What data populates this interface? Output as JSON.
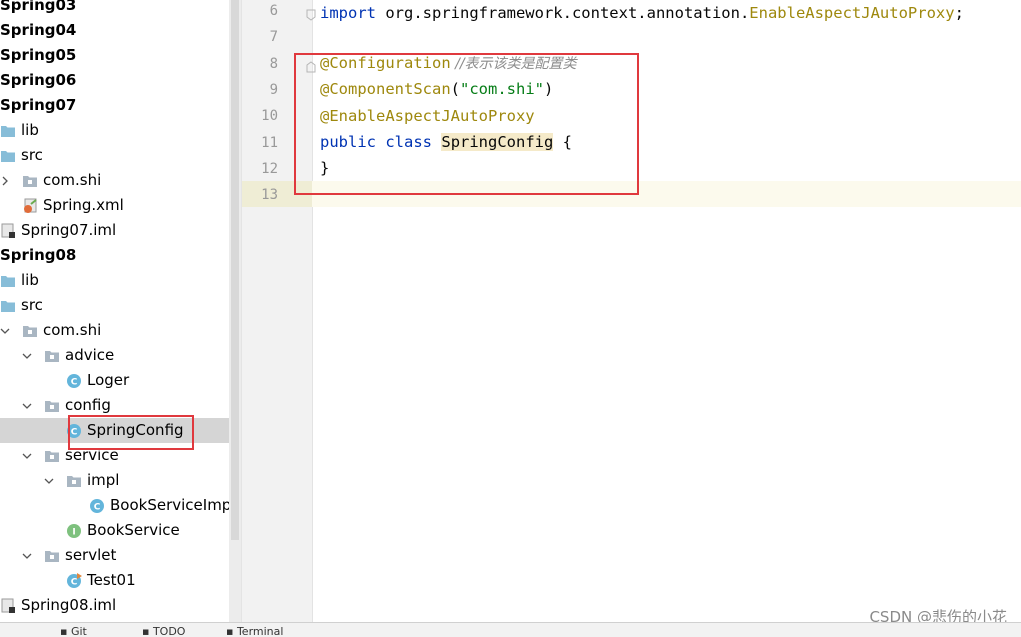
{
  "project_tree": {
    "items": [
      {
        "label": "Spring03",
        "kind": "module"
      },
      {
        "label": "Spring04",
        "kind": "module"
      },
      {
        "label": "Spring05",
        "kind": "module"
      },
      {
        "label": "Spring06",
        "kind": "module"
      },
      {
        "label": "Spring07",
        "kind": "module"
      },
      {
        "label": "lib",
        "kind": "folder"
      },
      {
        "label": "src",
        "kind": "folder"
      },
      {
        "label": "com.shi",
        "kind": "package"
      },
      {
        "label": "Spring.xml",
        "kind": "xml"
      },
      {
        "label": "Spring07.iml",
        "kind": "iml"
      },
      {
        "label": "Spring08",
        "kind": "module"
      },
      {
        "label": "lib",
        "kind": "folder"
      },
      {
        "label": "src",
        "kind": "folder"
      },
      {
        "label": "com.shi",
        "kind": "package"
      },
      {
        "label": "advice",
        "kind": "package"
      },
      {
        "label": "Loger",
        "kind": "class"
      },
      {
        "label": "config",
        "kind": "package"
      },
      {
        "label": "SpringConfig",
        "kind": "class",
        "selected": true
      },
      {
        "label": "service",
        "kind": "package"
      },
      {
        "label": "impl",
        "kind": "package"
      },
      {
        "label": "BookServiceImp",
        "kind": "class"
      },
      {
        "label": "BookService",
        "kind": "interface"
      },
      {
        "label": "servlet",
        "kind": "package"
      },
      {
        "label": "Test01",
        "kind": "class-run"
      },
      {
        "label": "Spring08.iml",
        "kind": "iml"
      }
    ]
  },
  "editor": {
    "line_numbers": [
      "6",
      "7",
      "8",
      "9",
      "10",
      "11",
      "12",
      "13"
    ],
    "lines": {
      "l6_kw": "import",
      "l6_pkg": " org.springframework.context.annotation.",
      "l6_cls": "EnableAspectJAutoProxy",
      "l6_end": ";",
      "l8_ann": "@Configuration",
      "l8_cmt": " //表示该类是配置类",
      "l9_ann": "@ComponentScan",
      "l9_open": "(",
      "l9_str": "\"com.shi\"",
      "l9_close": ")",
      "l10_ann": "@EnableAspectJAutoProxy",
      "l11_kw1": "public",
      "l11_sp": " ",
      "l11_kw2": "class",
      "l11_sp2": " ",
      "l11_name": "SpringConfig",
      "l11_brace": " {",
      "l12_brace": "}"
    }
  },
  "watermark": "CSDN @悲伤的小花",
  "statusbar": {
    "items": [
      "Git",
      "TODO",
      "Terminal"
    ]
  },
  "colors": {
    "annotation": "#9e880d",
    "keyword": "#0033b3",
    "string": "#067d17",
    "highlight_box": "#e0393e"
  }
}
